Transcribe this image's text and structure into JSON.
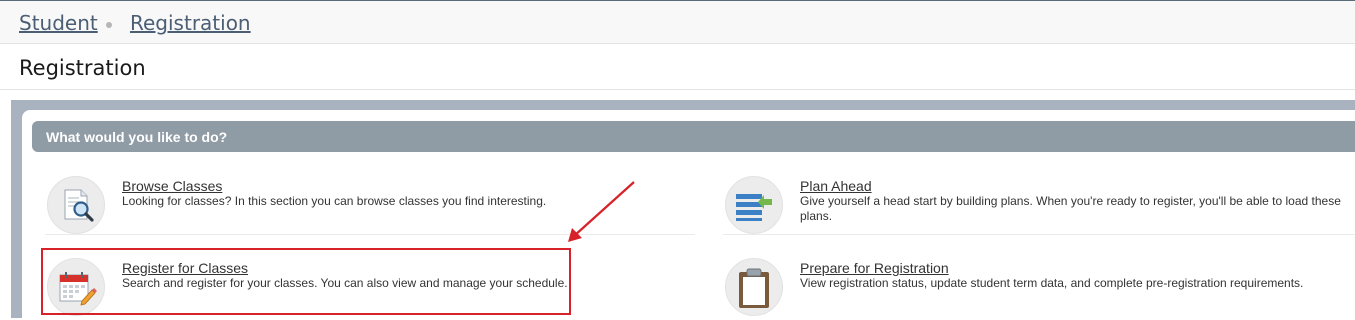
{
  "breadcrumb": {
    "items": [
      {
        "label": "Student"
      },
      {
        "label": "Registration"
      }
    ]
  },
  "page": {
    "title": "Registration"
  },
  "panel": {
    "heading": "What would you like to do?"
  },
  "tiles": [
    {
      "title": "Browse Classes",
      "description": "Looking for classes? In this section you can browse classes you find interesting.",
      "icon": "magnifier-document-icon"
    },
    {
      "title": "Plan Ahead",
      "description": "Give yourself a head start by building plans. When you're ready to register, you'll be able to load these plans.",
      "icon": "plan-list-icon"
    },
    {
      "title": "Register for Classes",
      "description": "Search and register for your classes. You can also view and manage your schedule.",
      "icon": "calendar-pencil-icon"
    },
    {
      "title": "Prepare for Registration",
      "description": "View registration status, update student term data, and complete pre-registration requirements.",
      "icon": "clipboard-icon"
    }
  ],
  "annotation": {
    "color": "#d62228"
  }
}
